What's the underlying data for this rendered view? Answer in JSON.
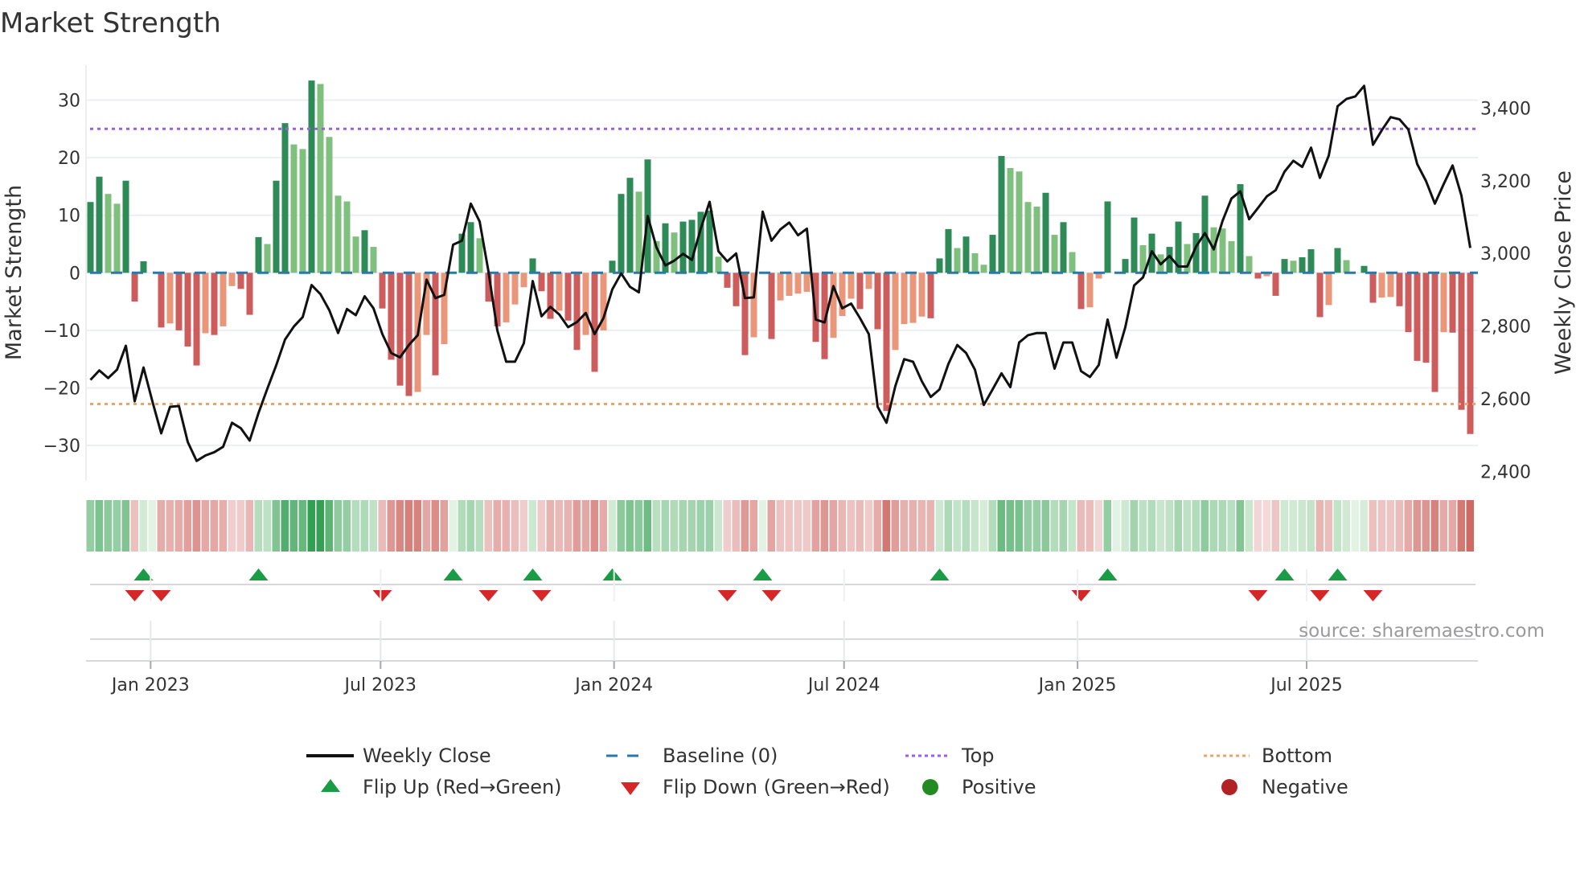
{
  "title": "Market Strength",
  "source": "source: sharemaestro.com",
  "colors": {
    "close": "#111111",
    "baseline": "#2a78a8",
    "top": "#9b5de5",
    "bottom": "#f4a261",
    "bar_pos_dark": "#2e8b57",
    "bar_pos_light": "#80c07f",
    "bar_neg_dark": "#cd5c5c",
    "bar_neg_light": "#e9967a",
    "flip_up": "#1a9c47",
    "flip_down": "#d62728",
    "positive": "#228b22",
    "negative": "#b22222"
  },
  "legend": {
    "close": "Weekly Close",
    "baseline": "Baseline (0)",
    "top": "Top",
    "bottom": "Bottom",
    "flip_up": "Flip Up (Red→Green)",
    "flip_down": "Flip Down (Green→Red)",
    "positive": "Positive",
    "negative": "Negative"
  },
  "chart_data": {
    "type": "bar",
    "title": "Market Strength",
    "ylabel": "Market Strength",
    "y2label": "Weekly Close Price",
    "ylim": [
      -36,
      36
    ],
    "y2lim": [
      2370,
      3515
    ],
    "yticks": [
      -30,
      -20,
      -10,
      0,
      10,
      20,
      30
    ],
    "y2ticks": [
      2400,
      2600,
      2800,
      3000,
      3200,
      3400
    ],
    "y2tick_labels": [
      "2,400",
      "2,600",
      "2,800",
      "3,000",
      "3,200",
      "3,400"
    ],
    "xticks": [
      {
        "label": "Jan 2023",
        "week": 6.8
      },
      {
        "label": "Jul 2023",
        "week": 32.8
      },
      {
        "label": "Jan 2024",
        "week": 59.2
      },
      {
        "label": "Jul 2024",
        "week": 85.2
      },
      {
        "label": "Jan 2025",
        "week": 111.6
      },
      {
        "label": "Jul 2025",
        "week": 137.5
      }
    ],
    "top_level": 25,
    "bottom_level": -22.8,
    "baseline": 0,
    "strength": [
      12.3,
      16.7,
      13.7,
      12,
      16,
      -5,
      2,
      0,
      -9.5,
      -8.8,
      -10,
      -12.8,
      -16.1,
      -10.5,
      -10.8,
      -9.3,
      -2.3,
      -2.8,
      -7.3,
      6.2,
      5,
      16,
      26,
      22.3,
      21.5,
      33.4,
      32.8,
      23.6,
      13.4,
      12.4,
      6.3,
      7.4,
      4.5,
      -6.2,
      -15.1,
      -19.6,
      -21.4,
      -20.7,
      -10.8,
      -17.8,
      -12.4,
      0,
      6.8,
      8.8,
      6,
      -5,
      -9.3,
      -8.6,
      -5.5,
      -2.5,
      2.5,
      -3.2,
      -8,
      -6.6,
      -8.3,
      -13.4,
      -10.8,
      -17.2,
      -10,
      2.1,
      13.7,
      16.5,
      14.1,
      19.7,
      5.5,
      8.6,
      7,
      8.9,
      9.2,
      10.6,
      10.8,
      2.8,
      -2.6,
      -5.8,
      -14.3,
      -11.2,
      0,
      -11.5,
      -4.8,
      -4,
      -3.6,
      -3.3,
      -12,
      -15,
      -11.3,
      -7.5,
      -4.5,
      -6.3,
      -2.8,
      -9.8,
      -24,
      -13.4,
      -8.9,
      -8.7,
      -7.6,
      -7.9,
      2.5,
      7.6,
      4.3,
      6.3,
      3.4,
      1.4,
      6.6,
      20.3,
      18.2,
      17.6,
      12.3,
      11.5,
      13.9,
      6.6,
      8.8,
      3.6,
      -6.3,
      -6,
      -1,
      12.4,
      0,
      2.4,
      9.6,
      4.8,
      6.8,
      3.2,
      4.5,
      8.9,
      5,
      6.9,
      13.4,
      7.9,
      7.7,
      5.5,
      15.4,
      2.9,
      -1,
      -0.6,
      -4,
      2.4,
      2.1,
      2.7,
      4.1,
      -7.7,
      -5.6,
      4.3,
      2.2,
      0,
      1.2,
      -5.2,
      -4.3,
      -4.2,
      -5.8,
      -10.3,
      -15.3,
      -15.6,
      -20.7,
      -10.3,
      -10.4,
      -23.8,
      -28
    ],
    "close": [
      2652,
      2678,
      2657,
      2680,
      2746,
      2593,
      2686,
      2593,
      2505,
      2578,
      2580,
      2481,
      2429,
      2444,
      2453,
      2468,
      2534,
      2519,
      2485,
      2561,
      2628,
      2692,
      2763,
      2799,
      2825,
      2913,
      2888,
      2844,
      2781,
      2847,
      2830,
      2882,
      2849,
      2778,
      2726,
      2714,
      2748,
      2775,
      2928,
      2877,
      2886,
      3024,
      3035,
      3137,
      3088,
      2950,
      2788,
      2702,
      2702,
      2753,
      2924,
      2827,
      2853,
      2832,
      2797,
      2811,
      2836,
      2778,
      2822,
      2901,
      2945,
      2908,
      2893,
      3103,
      3016,
      2967,
      2980,
      2999,
      2982,
      3068,
      3142,
      3006,
      2978,
      3000,
      2877,
      2879,
      3115,
      3035,
      3066,
      3085,
      3050,
      3068,
      2818,
      2810,
      2910,
      2849,
      2862,
      2822,
      2778,
      2578,
      2534,
      2635,
      2709,
      2702,
      2648,
      2605,
      2626,
      2696,
      2748,
      2726,
      2680,
      2583,
      2626,
      2670,
      2632,
      2755,
      2775,
      2781,
      2781,
      2683,
      2755,
      2755,
      2676,
      2660,
      2693,
      2818,
      2713,
      2797,
      2912,
      2934,
      3006,
      2970,
      2993,
      2964,
      2964,
      3019,
      3056,
      3011,
      3090,
      3151,
      3171,
      3094,
      3125,
      3157,
      3174,
      3225,
      3255,
      3238,
      3291,
      3208,
      3269,
      3405,
      3425,
      3432,
      3461,
      3299,
      3339,
      3375,
      3369,
      3341,
      3246,
      3199,
      3137,
      3191,
      3242,
      3159,
      3015
    ],
    "flip_up_weeks": [
      6,
      19,
      41,
      50,
      59,
      76,
      96,
      115,
      135,
      141
    ],
    "flip_down_weeks": [
      5,
      8,
      33,
      45,
      51,
      72,
      77,
      112,
      132,
      139,
      145
    ]
  }
}
